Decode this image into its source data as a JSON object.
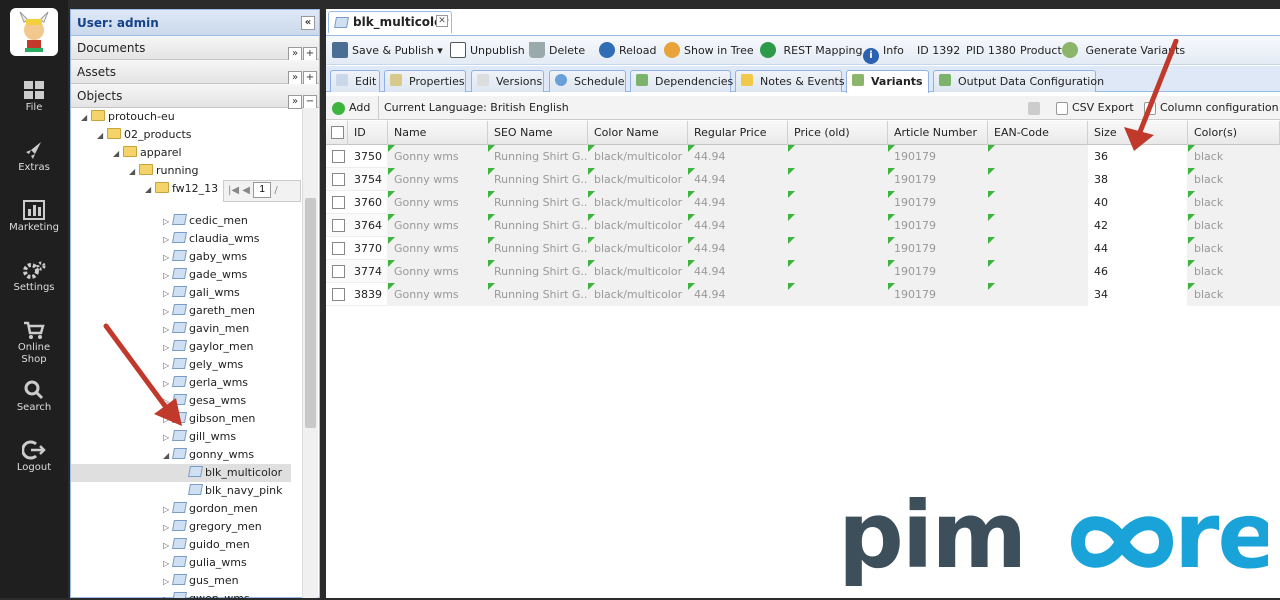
{
  "leftnav": {
    "items": [
      {
        "label": "File",
        "icon": "grid-icon"
      },
      {
        "label": "Extras",
        "icon": "rocket-icon"
      },
      {
        "label": "Marketing",
        "icon": "bar-chart-icon"
      },
      {
        "label": "Settings",
        "icon": "gear-icon"
      },
      {
        "label": "Online Shop",
        "icon": "cart-icon"
      },
      {
        "label": "Search",
        "icon": "search-icon"
      },
      {
        "label": "Logout",
        "icon": "logout-icon"
      }
    ]
  },
  "treepanel": {
    "user": "User: admin",
    "accordion": {
      "documents": "Documents",
      "assets": "Assets",
      "objects": "Objects"
    },
    "pager_page": "1",
    "nodes": [
      {
        "label": "protouch-eu",
        "type": "folder"
      },
      {
        "label": "02_products",
        "type": "folder"
      },
      {
        "label": "apparel",
        "type": "folder"
      },
      {
        "label": "running",
        "type": "folder"
      },
      {
        "label": "fw12_13",
        "type": "folder"
      },
      {
        "label": "cedic_men",
        "type": "object"
      },
      {
        "label": "claudia_wms",
        "type": "object"
      },
      {
        "label": "gaby_wms",
        "type": "object"
      },
      {
        "label": "gade_wms",
        "type": "object"
      },
      {
        "label": "gali_wms",
        "type": "object"
      },
      {
        "label": "gareth_men",
        "type": "object"
      },
      {
        "label": "gavin_men",
        "type": "object"
      },
      {
        "label": "gaylor_men",
        "type": "object"
      },
      {
        "label": "gely_wms",
        "type": "object"
      },
      {
        "label": "gerla_wms",
        "type": "object"
      },
      {
        "label": "gesa_wms",
        "type": "object"
      },
      {
        "label": "gibson_men",
        "type": "object"
      },
      {
        "label": "gill_wms",
        "type": "object"
      },
      {
        "label": "gonny_wms",
        "type": "object"
      },
      {
        "label": "blk_multicolor",
        "type": "variant"
      },
      {
        "label": "blk_navy_pink",
        "type": "variant"
      },
      {
        "label": "gordon_men",
        "type": "object"
      },
      {
        "label": "gregory_men",
        "type": "object"
      },
      {
        "label": "guido_men",
        "type": "object"
      },
      {
        "label": "gulia_wms",
        "type": "object"
      },
      {
        "label": "gus_men",
        "type": "object"
      },
      {
        "label": "gwen_wms",
        "type": "object"
      }
    ]
  },
  "main": {
    "doc_tab": "blk_multicolor",
    "toolbar": {
      "save_publish": "Save & Publish",
      "unpublish": "Unpublish",
      "delete": "Delete",
      "reload": "Reload",
      "show_in_tree": "Show in Tree",
      "rest_mapping": "REST Mapping",
      "info": "Info",
      "id": "ID 1392",
      "pid": "PID 1380",
      "class": "Product",
      "generate_variants": "Generate Variants"
    },
    "tabs": [
      "Edit",
      "Properties",
      "Versions",
      "Schedule",
      "Dependencies",
      "Notes & Events",
      "Variants",
      "Output Data Configuration"
    ],
    "gridbar": {
      "add": "Add",
      "language": "Current Language: British English",
      "csv_export": "CSV Export",
      "column_config": "Column configuration"
    },
    "columns": [
      "ID",
      "Name",
      "SEO Name",
      "Color Name",
      "Regular Price",
      "Price (old)",
      "Article Number",
      "EAN-Code",
      "Size",
      "Color(s)"
    ],
    "rows": [
      [
        "3750",
        "Gonny wms",
        "Running Shirt G...",
        "black/multicolor",
        "44.94",
        "",
        "190179",
        "",
        "36",
        "black"
      ],
      [
        "3754",
        "Gonny wms",
        "Running Shirt G...",
        "black/multicolor",
        "44.94",
        "",
        "190179",
        "",
        "38",
        "black"
      ],
      [
        "3760",
        "Gonny wms",
        "Running Shirt G...",
        "black/multicolor",
        "44.94",
        "",
        "190179",
        "",
        "40",
        "black"
      ],
      [
        "3764",
        "Gonny wms",
        "Running Shirt G...",
        "black/multicolor",
        "44.94",
        "",
        "190179",
        "",
        "42",
        "black"
      ],
      [
        "3770",
        "Gonny wms",
        "Running Shirt G...",
        "black/multicolor",
        "44.94",
        "",
        "190179",
        "",
        "44",
        "black"
      ],
      [
        "3774",
        "Gonny wms",
        "Running Shirt G...",
        "black/multicolor",
        "44.94",
        "",
        "190179",
        "",
        "46",
        "black"
      ],
      [
        "3839",
        "Gonny wms",
        "Running Shirt G...",
        "black/multicolor",
        "44.94",
        "",
        "190179",
        "",
        "34",
        "black"
      ]
    ]
  },
  "brand": {
    "logo_text": "pimcore",
    "colors": {
      "dark": "#3d4f5a",
      "accent": "#1aa3d9",
      "arrow": "#c0392b"
    }
  }
}
